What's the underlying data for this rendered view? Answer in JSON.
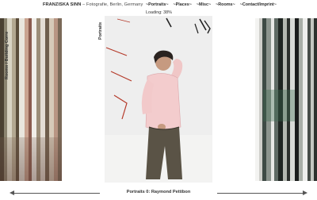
{
  "header": {
    "name": "FRANZISKA SINN",
    "tagline": " – Fotografie, Berlin, Germany",
    "nav": [
      {
        "label": "~Portraits~"
      },
      {
        "label": "~Places~"
      },
      {
        "label": "~Misc~"
      },
      {
        "label": "~Rooms~"
      },
      {
        "label": "~Contact/Imprint~"
      }
    ],
    "loading": "Loading: 38%"
  },
  "left_strip": {
    "label": "Rooms / Building Corre"
  },
  "gallery": {
    "section_label": "Portraits"
  },
  "footer": {
    "caption": "Portraits 0: Raymond Pettibon"
  },
  "icons": {
    "prev": "arrow-left-icon",
    "next": "arrow-right-icon"
  }
}
